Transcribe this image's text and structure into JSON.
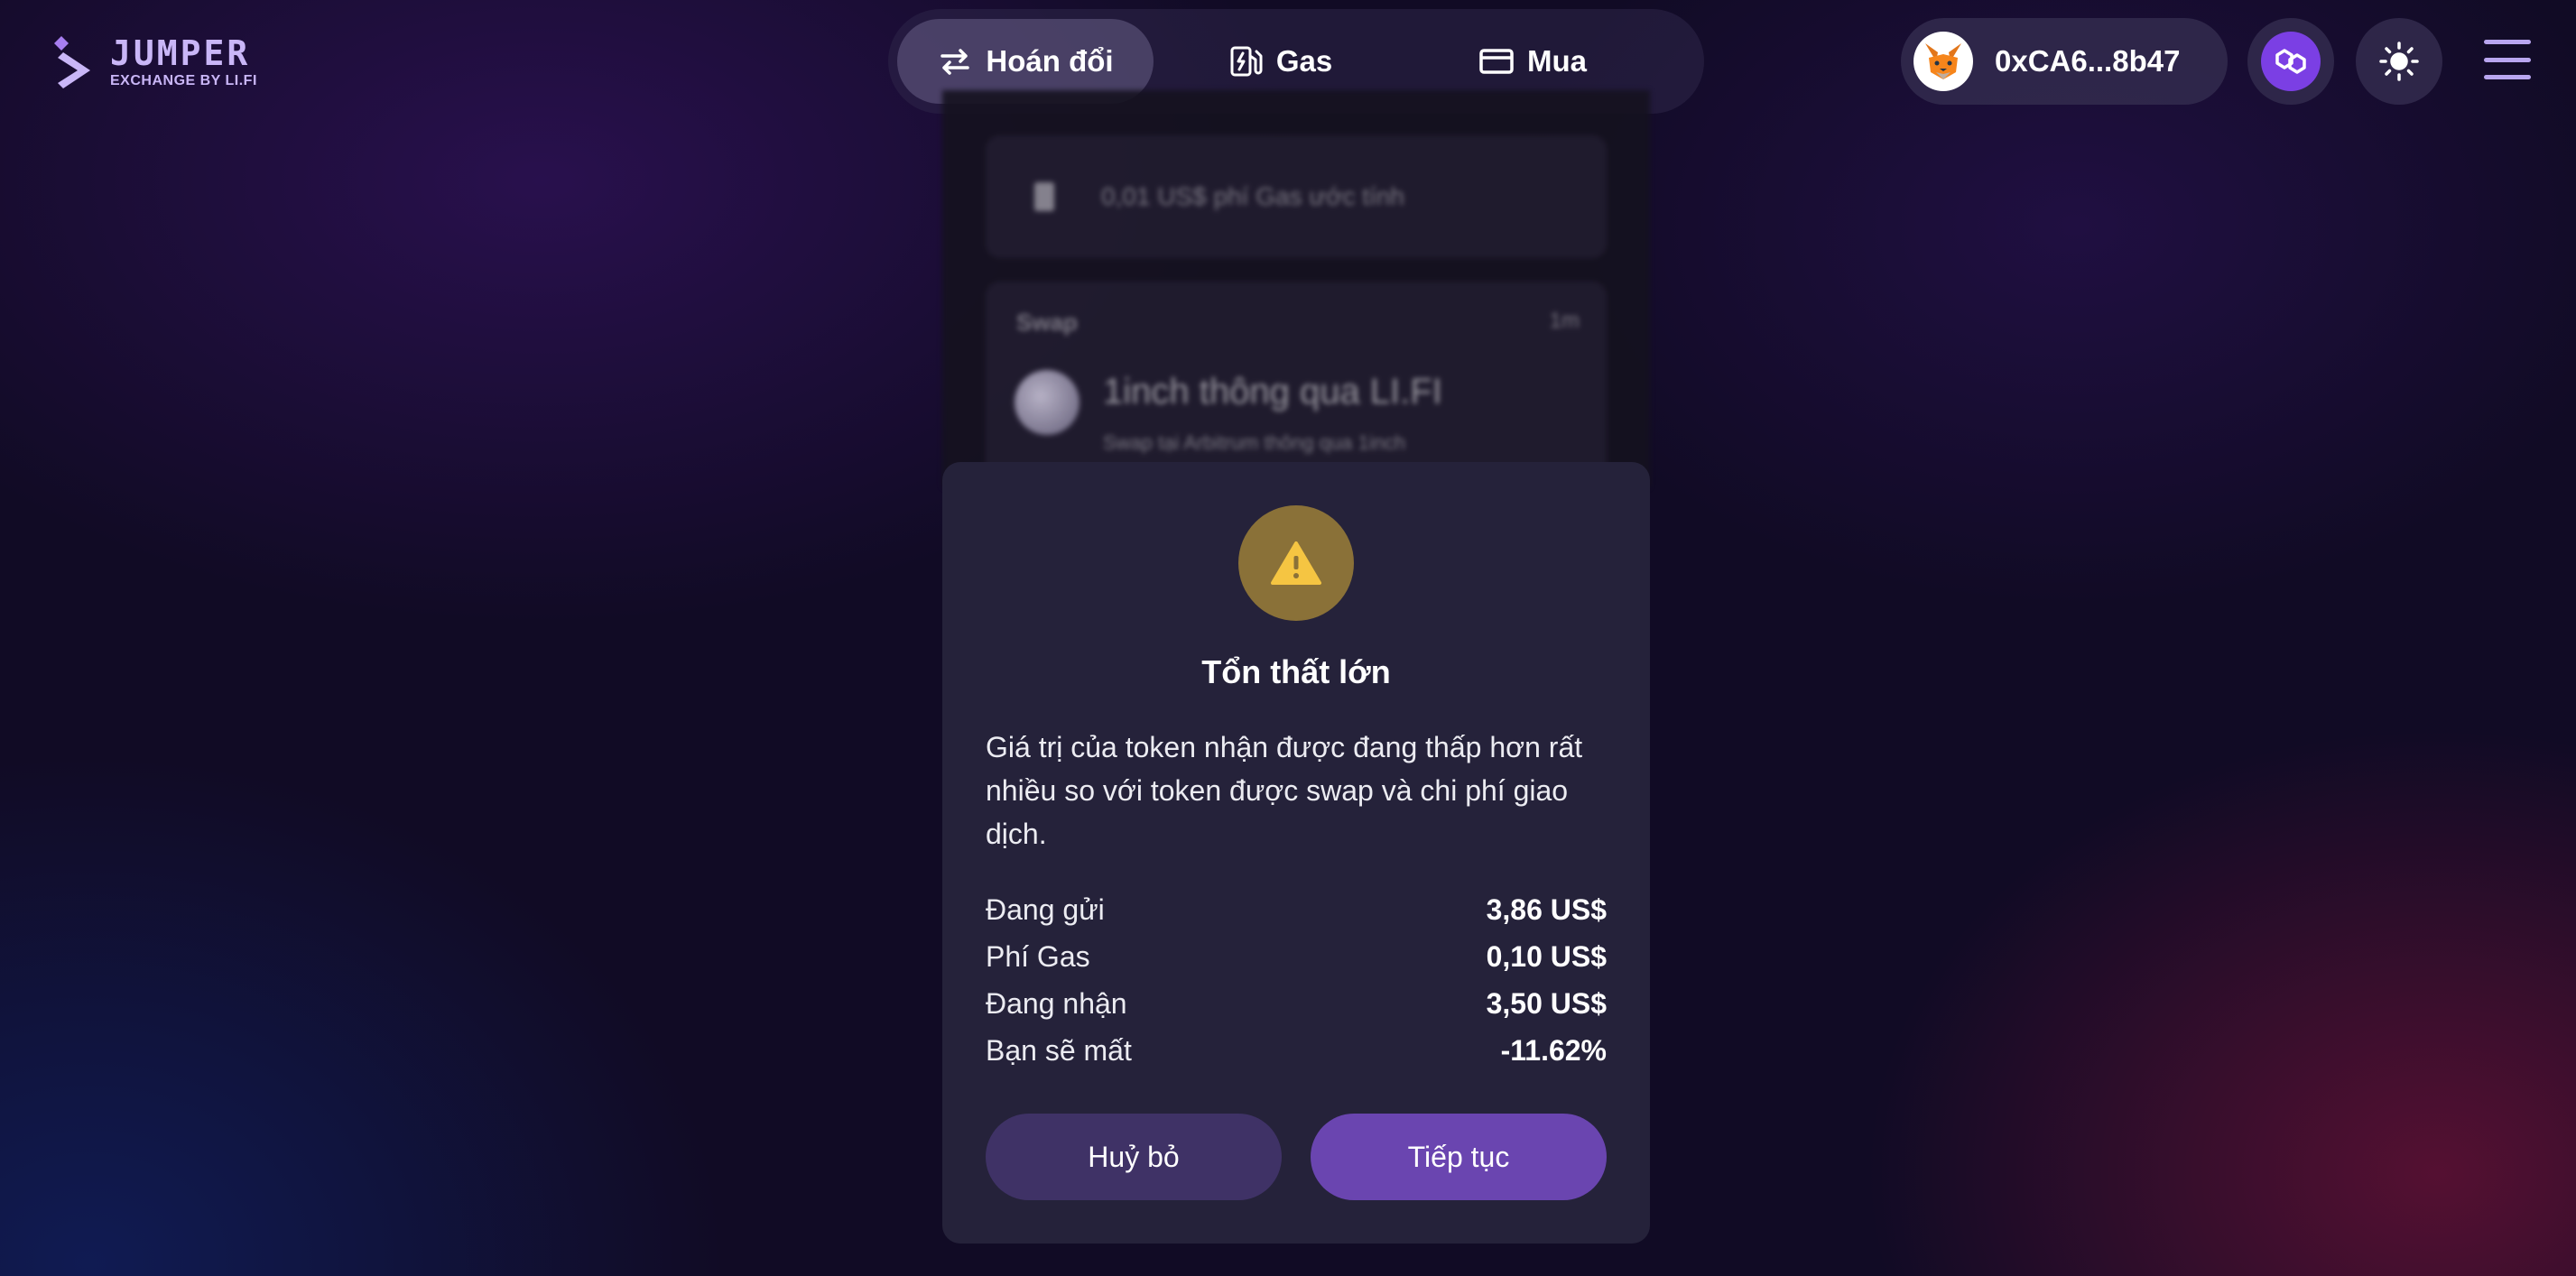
{
  "brand": {
    "name": "JUMPER",
    "tagline": "EXCHANGE BY LI.FI",
    "accent_color": "#c9b6f7"
  },
  "nav": {
    "tabs": [
      {
        "label": "Hoán đổi",
        "icon": "swap-arrows-icon",
        "active": true
      },
      {
        "label": "Gas",
        "icon": "gas-pump-icon",
        "active": false
      },
      {
        "label": "Mua",
        "icon": "credit-card-icon",
        "active": false
      }
    ]
  },
  "wallet": {
    "address": "0xCA6...8b47",
    "icon": "metamask-fox-icon",
    "chain_icon": "polygon-icon",
    "chain_color": "#7b3fe4"
  },
  "header_icons": {
    "theme": "sun-icon",
    "menu": "hamburger-menu-icon"
  },
  "background_card": {
    "gas_fee_text": "0,01 US$ phí Gas ước tính",
    "swap_label": "Swap",
    "swap_time": "1m",
    "provider": "1inch thông qua LI.FI",
    "provider_desc": "Swap tại Arbitrum thông qua 1inch"
  },
  "dialog": {
    "icon": "warning-triangle-icon",
    "icon_color": "#f5c542",
    "title": "Tổn thất lớn",
    "message": "Giá trị của token nhận được đang thấp hơn rất nhiều so với token được swap và chi phí giao dịch.",
    "rows": [
      {
        "label": "Đang gửi",
        "value": "3,86 US$"
      },
      {
        "label": "Phí Gas",
        "value": "0,10 US$"
      },
      {
        "label": "Đang nhận",
        "value": "3,50 US$"
      },
      {
        "label": "Bạn sẽ mất",
        "value": "-11.62%"
      }
    ],
    "cancel_label": "Huỷ bỏ",
    "continue_label": "Tiếp tục"
  }
}
